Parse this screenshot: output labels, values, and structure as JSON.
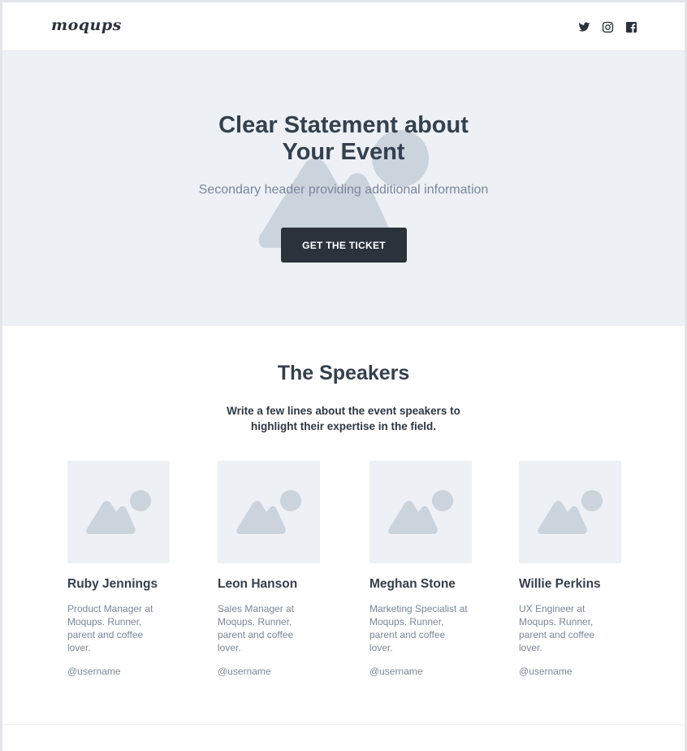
{
  "brand": {
    "logo_text": "moqups"
  },
  "social": [
    {
      "name": "twitter-icon"
    },
    {
      "name": "instagram-icon"
    },
    {
      "name": "facebook-icon"
    }
  ],
  "hero": {
    "title_line1": "Clear Statement about",
    "title_line2": "Your Event",
    "subtitle": "Secondary header providing additional information",
    "button_label": "GET THE TICKET"
  },
  "speakers_section": {
    "title": "The Speakers",
    "intro": "Write a few lines about the event speakers to highlight their expertise in the field."
  },
  "speakers": [
    {
      "name": "Ruby Jennings",
      "bio": "Product Manager at\nMoqups. Runner,\nparent and coffee\nlover.",
      "handle": "@username"
    },
    {
      "name": "Leon Hanson",
      "bio": "Sales Manager at\nMoqups.  Runner,\nparent and coffee\nlover.",
      "handle": "@username"
    },
    {
      "name": "Meghan Stone",
      "bio": "Marketing Specialist at\nMoqups. Runner,\nparent and coffee\nlover.",
      "handle": "@username"
    },
    {
      "name": "Willie Perkins",
      "bio": "UX Engineer at\nMoqups. Runner,\nparent and coffee\nlover.",
      "handle": "@username"
    }
  ],
  "colors": {
    "accent_dark": "#2b323c",
    "hero_bg": "#edf0f4",
    "placeholder": "#cbd3dd",
    "text_muted": "#7b879a"
  }
}
